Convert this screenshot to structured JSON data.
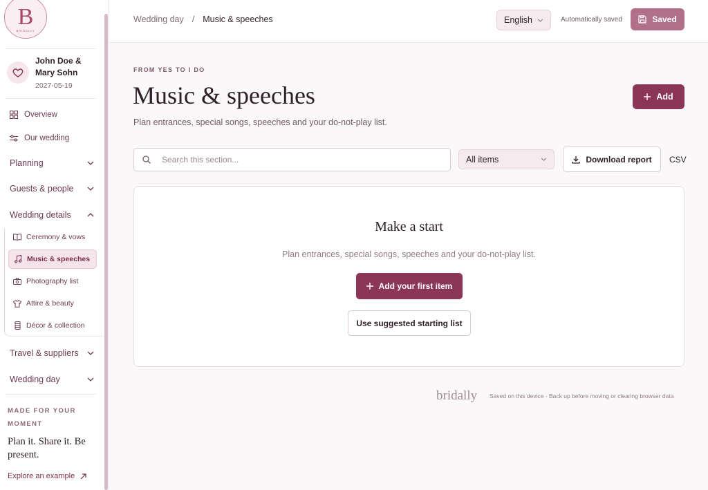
{
  "app": {
    "logo_letter": "B",
    "logo_word": "BRIDALLY"
  },
  "couple": {
    "name": "John Doe & Mary Sohn",
    "date": "2027-05-19"
  },
  "sidebar": {
    "items": [
      {
        "label": "Overview",
        "icon": "grid-icon"
      },
      {
        "label": "Our wedding",
        "icon": "sliders-icon"
      }
    ],
    "groups": [
      {
        "label": "Planning",
        "expanded": false
      },
      {
        "label": "Guests & people",
        "expanded": false
      },
      {
        "label": "Wedding details",
        "expanded": true
      },
      {
        "label": "Travel & suppliers",
        "expanded": false
      },
      {
        "label": "Wedding day",
        "expanded": false
      }
    ],
    "subitems": [
      {
        "label": "Ceremony & vows",
        "icon": "book-icon",
        "active": false
      },
      {
        "label": "Music & speeches",
        "icon": "music-icon",
        "active": true
      },
      {
        "label": "Photography list",
        "icon": "camera-icon",
        "active": false
      },
      {
        "label": "Attire & beauty",
        "icon": "shirt-icon",
        "active": false
      },
      {
        "label": "Décor & collection",
        "icon": "decor-icon",
        "active": false
      }
    ],
    "made_for": "MADE FOR YOUR MOMENT",
    "tagline": "Plan it. Share it. Be present.",
    "explore": "Explore an example"
  },
  "topbar": {
    "breadcrumb": [
      "Wedding day",
      "Music & speeches"
    ],
    "breadcrumb_separator": "/",
    "language": "English",
    "autosave": "Automatically saved",
    "saved_label": "Saved"
  },
  "main": {
    "eyebrow": "FROM YES TO I DO",
    "title": "Music & speeches",
    "subtitle": "Plan entrances, special songs, speeches and your do-not-play list.",
    "add_label": "Add",
    "search_placeholder": "Search this section...",
    "filter_value": "All items",
    "download_label": "Download report",
    "csv_label": "CSV",
    "empty": {
      "title": "Make a start",
      "subtitle": "Plan entrances, special songs, speeches and your do-not-play list.",
      "primary_label": "Add your first item",
      "secondary_label": "Use suggested starting list"
    },
    "footer_brand": "bridally",
    "footer_note": "Saved on this device · Back up before moving or clearing browser data"
  },
  "colors": {
    "accent": "#8b3656",
    "saved_button": "#b0708a",
    "active_nav_bg": "#f6e4eb"
  }
}
